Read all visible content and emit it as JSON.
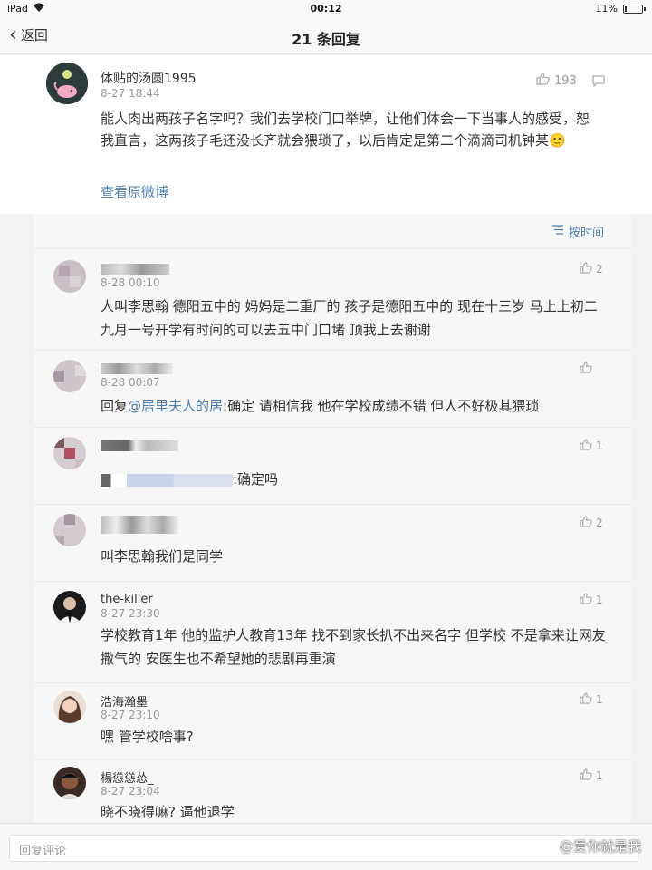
{
  "status_bar": {
    "device": "iPad",
    "time": "00:12",
    "battery": "11%",
    "battery_level": 0.11
  },
  "nav": {
    "back_label": "返回",
    "title": "21 条回复"
  },
  "post": {
    "username": "体贴的汤圆1995",
    "timestamp": "8-27 18:44",
    "like_count": "193",
    "text": "能人肉出两孩子名字吗？我们去学校门口举牌，让他们体会一下当事人的感受，恕我直言，这两孩子毛还没长齐就会猥琐了，以后肯定是第二个滴滴司机钟某🙂",
    "view_original_label": "查看原微博"
  },
  "sort": {
    "label": "按时间"
  },
  "comments": [
    {
      "username": "",
      "timestamp": "8-28 00:10",
      "like_count": "2",
      "text": "人叫李思翰 德阳五中的 妈妈是二重厂的 孩子是德阳五中的 现在十三岁 马上上初二 九月一号开学有时间的可以去五中门口堵 顶我上去谢谢"
    },
    {
      "username": "",
      "timestamp": "8-28 00:07",
      "like_count": "",
      "reply_prefix": "回复",
      "mention": "@居里夫人的居",
      "text": ":确定 请相信我 他在学校成绩不错 但人不好极其猥琐"
    },
    {
      "username": "",
      "timestamp": "",
      "like_count": "1",
      "text": ":确定吗"
    },
    {
      "username": "",
      "timestamp": "",
      "like_count": "2",
      "text": "叫李思翰我们是同学"
    },
    {
      "username": "the-killer",
      "timestamp": "8-27 23:30",
      "like_count": "1",
      "text": "学校教育1年 他的监护人教育13年 找不到家长扒不出来名字 但学校 不是拿来让网友撒气的 安医生也不希望她的悲剧再重演"
    },
    {
      "username": "浩海瀚墨",
      "timestamp": "8-27 23:10",
      "like_count": "1",
      "text": "嘿  管学校啥事?"
    },
    {
      "username": "楊慫慫怂_",
      "timestamp": "8-27 23:04",
      "like_count": "1",
      "text": "晓不晓得嘛? 逼他退学"
    }
  ],
  "input": {
    "placeholder": "回复评论"
  },
  "watermark": {
    "text": "@爱你就是我"
  },
  "colors": {
    "link": "#507daf",
    "muted": "#999999",
    "background": "#f2f2f2"
  }
}
